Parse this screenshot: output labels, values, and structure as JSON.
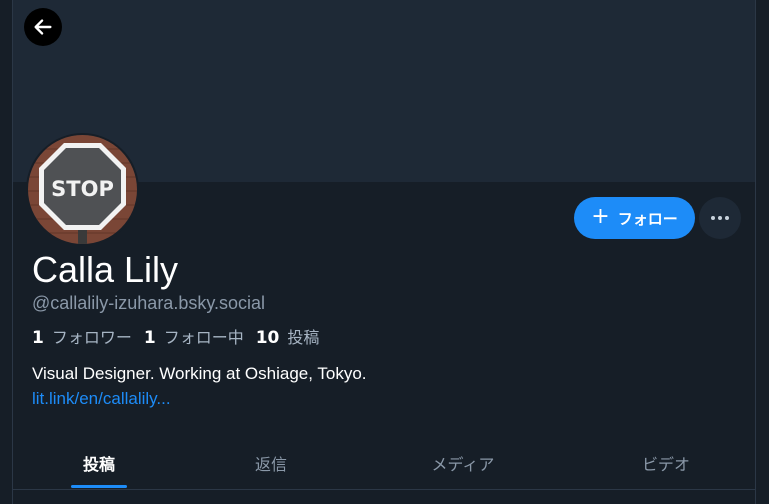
{
  "profile": {
    "display_name": "Calla Lily",
    "handle": "@callalily-izuhara.bsky.social",
    "bio": "Visual Designer. Working at Oshiage, Tokyo.",
    "link": "lit.link/en/callalily...",
    "avatar_text": "STOP"
  },
  "stats": {
    "followers_count": "1",
    "followers_label": "フォロワー",
    "following_count": "1",
    "following_label": "フォロー中",
    "posts_count": "10",
    "posts_label": "投稿"
  },
  "actions": {
    "follow_label": "フォロー",
    "follow_icon": "plus-icon",
    "more_icon": "ellipsis-icon",
    "back_icon": "arrow-left-icon"
  },
  "tabs": [
    {
      "label": "投稿",
      "active": true
    },
    {
      "label": "返信",
      "active": false
    },
    {
      "label": "メディア",
      "active": false
    },
    {
      "label": "ビデオ",
      "active": false
    }
  ],
  "colors": {
    "accent": "#1d8cf8",
    "background": "#161e27",
    "banner": "#1e2936"
  }
}
